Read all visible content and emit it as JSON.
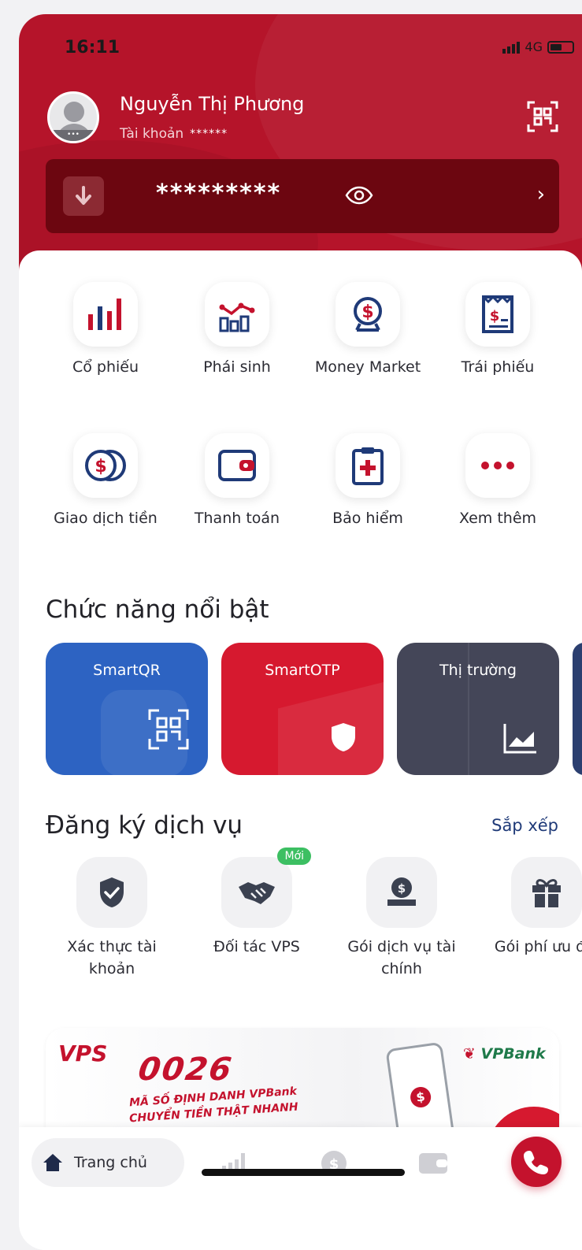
{
  "status_bar": {
    "time": "16:11",
    "network": "4G"
  },
  "header": {
    "user_name": "Nguyễn Thị Phương",
    "account_label": "Tài khoản",
    "account_number": "******",
    "balance": "*********"
  },
  "products": [
    {
      "label": "Cổ phiếu",
      "icon": "stock-bars-icon"
    },
    {
      "label": "Phái sinh",
      "icon": "derivative-chart-icon"
    },
    {
      "label": "Money Market",
      "icon": "money-market-icon"
    },
    {
      "label": "Trái phiếu",
      "icon": "bond-receipt-icon"
    },
    {
      "label": "Giao dịch tiền",
      "icon": "coins-icon"
    },
    {
      "label": "Thanh toán",
      "icon": "wallet-icon"
    },
    {
      "label": "Bảo hiểm",
      "icon": "insurance-clipboard-icon"
    },
    {
      "label": "Xem thêm",
      "icon": "more-dots-icon"
    }
  ],
  "featured": {
    "title": "Chức năng nổi bật",
    "cards": [
      {
        "title": "SmartQR",
        "color": "#2d63c2"
      },
      {
        "title": "SmartOTP",
        "color": "#d6192f"
      },
      {
        "title": "Thị trường",
        "color": "#444658"
      }
    ]
  },
  "services": {
    "title": "Đăng ký dịch vụ",
    "sort_label": "Sắp xếp",
    "items": [
      {
        "label": "Xác thực tài khoản",
        "icon": "shield-check-icon"
      },
      {
        "label": "Đối tác VPS",
        "icon": "handshake-icon",
        "badge": "Mới"
      },
      {
        "label": "Gói dịch vụ tài chính",
        "icon": "money-bag-icon"
      },
      {
        "label": "Gói phí ưu đãi",
        "icon": "gift-icon"
      }
    ]
  },
  "banner": {
    "vps_logo": "VPS",
    "code": "0026",
    "line1": "MÃ SỐ ĐỊNH DANH VPBank",
    "line2": "CHUYỂN TIỀN THẬT NHANH",
    "partner": "VPBank"
  },
  "bottom_nav": {
    "home_label": "Trang chủ"
  },
  "colors": {
    "brand_red": "#b5142a",
    "dark_red": "#6c0610",
    "link_blue": "#1f3a78",
    "badge_green": "#3cbf62"
  }
}
